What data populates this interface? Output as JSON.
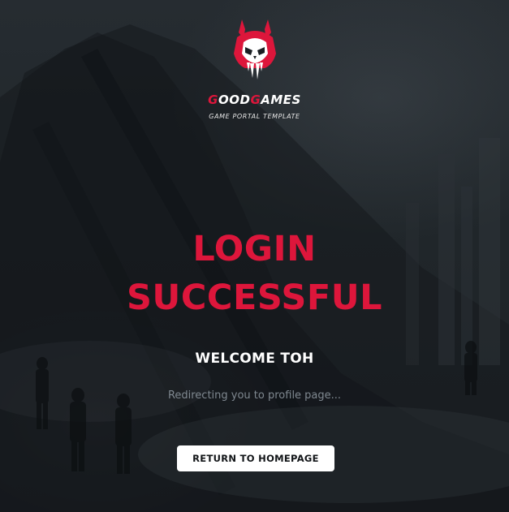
{
  "brand": {
    "name_parts": [
      "G",
      "OOD",
      "G",
      "AMES"
    ],
    "tagline": "GAME PORTAL TEMPLATE",
    "accent_color": "#dd163b"
  },
  "logo": {
    "icon": "skull-helmet-icon"
  },
  "message": {
    "title_line1": "LOGIN",
    "title_line2": "SUCCESSFUL",
    "welcome": "WELCOME TOH",
    "redirect": "Redirecting you to profile page..."
  },
  "actions": {
    "return_label": "RETURN TO HOMEPAGE"
  },
  "colors": {
    "background": "#1b2024",
    "title": "#dd163b",
    "button_bg": "#ffffff",
    "muted_text": "#7f8890"
  }
}
